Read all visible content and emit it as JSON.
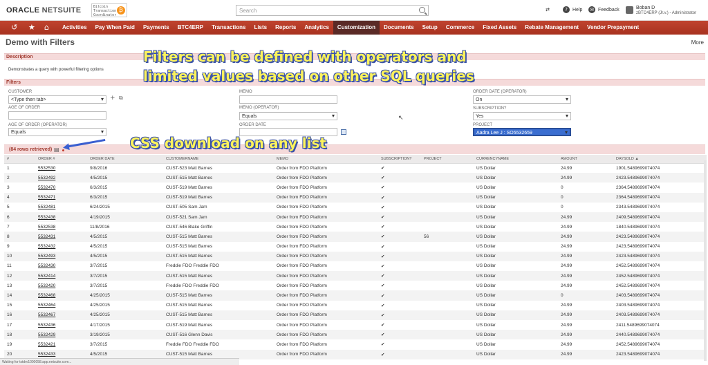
{
  "header": {
    "logo_main": "ORACLE",
    "logo_sub": "NETSUITE",
    "coin_text": "Bitcoin Transaction Coordinator",
    "coin_symbol": "₿",
    "search_placeholder": "Search",
    "help": "Help",
    "feedback": "Feedback",
    "user_name": "Boban D",
    "user_role": "zBTC4ERP (Jr.v.) - Administrator"
  },
  "nav": {
    "items": [
      "Activities",
      "Pay When Paid",
      "Payments",
      "BTC4ERP",
      "Transactions",
      "Lists",
      "Reports",
      "Analytics",
      "Customization",
      "Documents",
      "Setup",
      "Commerce",
      "Fixed Assets",
      "Rebate Management",
      "Vendor Prepayment"
    ],
    "active": "Customization"
  },
  "page": {
    "title": "Demo with Filters",
    "more": "More",
    "description_section": "Description",
    "description_text": "Demonstrates a query with powerful filtering options",
    "filters_section": "Filters"
  },
  "overlay": {
    "line1": "Filters can be defined with operators and",
    "line2": "limited values based on other SQL queries",
    "line3": "CSS download on any list"
  },
  "filters": {
    "customer_label": "CUSTOMER",
    "customer_value": "<Type then tab>",
    "age_label": "AGE OF ORDER",
    "age_value": "",
    "age_op_label": "AGE OF ORDER (OPERATOR)",
    "age_op_value": "Equals",
    "memo_label": "MEMO",
    "memo_value": "",
    "memo_op_label": "MEMO (OPERATOR)",
    "memo_op_value": "Equals",
    "order_date_label": "ORDER DATE",
    "order_date_value": "",
    "order_date_op_label": "ORDER DATE (OPERATOR)",
    "order_date_op_value": "On",
    "subscription_label": "SUBSCRIPTION?",
    "subscription_value": "Yes",
    "project_label": "PROJECT",
    "project_value": "Aadra Lee J : SO5532659"
  },
  "results": {
    "count_text": "(84 rows retrieved)",
    "columns": [
      "#",
      "ORDER #",
      "ORDER DATE",
      "CUSTOMERNAME",
      "MEMO",
      "SUBSCRIPTION?",
      "PROJECT",
      "CURRENCYNAME",
      "AMOUNT",
      "DAYSOLD ▲"
    ],
    "rows": [
      [
        "1",
        "5532530",
        "9/8/2016",
        "CUST-523 Matt Barnes",
        "Order from FDO Platform",
        "✔",
        "",
        "US Dollar",
        "24.99",
        "1901.5489699074074"
      ],
      [
        "2",
        "5532492",
        "4/5/2015",
        "CUST-515 Matt Barnes",
        "Order from FDO Platform",
        "✔",
        "",
        "US Dollar",
        "24.99",
        "2423.5489699074074"
      ],
      [
        "3",
        "5532470",
        "6/3/2015",
        "CUST-519 Matt Barnes",
        "Order from FDO Platform",
        "✔",
        "",
        "US Dollar",
        "0",
        "2364.5489699074074"
      ],
      [
        "4",
        "5532471",
        "6/3/2015",
        "CUST-519 Matt Barnes",
        "Order from FDO Platform",
        "✔",
        "",
        "US Dollar",
        "0",
        "2364.5489699074074"
      ],
      [
        "5",
        "5532481",
        "6/24/2015",
        "CUST-505 Sam Jam",
        "Order from FDO Platform",
        "✔",
        "",
        "US Dollar",
        "0",
        "2343.5489699074074"
      ],
      [
        "6",
        "5532438",
        "4/19/2015",
        "CUST-521 Sam Jam",
        "Order from FDO Platform",
        "✔",
        "",
        "US Dollar",
        "24.99",
        "2409.5489699074074"
      ],
      [
        "7",
        "5532538",
        "11/8/2016",
        "CUST-546 Blake Griffin",
        "Order from FDO Platform",
        "✔",
        "",
        "US Dollar",
        "24.99",
        "1840.5489699074074"
      ],
      [
        "8",
        "5532431",
        "4/5/2015",
        "CUST-515 Matt Barnes",
        "Order from FDO Platform",
        "✔",
        "56",
        "US Dollar",
        "24.99",
        "2423.5489699074074"
      ],
      [
        "9",
        "5532432",
        "4/5/2015",
        "CUST-515 Matt Barnes",
        "Order from FDO Platform",
        "✔",
        "",
        "US Dollar",
        "24.99",
        "2423.5489699074074"
      ],
      [
        "10",
        "5532493",
        "4/5/2015",
        "CUST-515 Matt Barnes",
        "Order from FDO Platform",
        "✔",
        "",
        "US Dollar",
        "24.99",
        "2423.5489699074074"
      ],
      [
        "11",
        "5532430",
        "3/7/2015",
        "Freddie FDO Freddie FDO",
        "Order from FDO Platform",
        "✔",
        "",
        "US Dollar",
        "24.99",
        "2452.5489699074074"
      ],
      [
        "12",
        "5532414",
        "3/7/2015",
        "CUST-515 Matt Barnes",
        "Order from FDO Platform",
        "✔",
        "",
        "US Dollar",
        "24.99",
        "2452.5489699074074"
      ],
      [
        "13",
        "5532420",
        "3/7/2015",
        "Freddie FDO Freddie FDO",
        "Order from FDO Platform",
        "✔",
        "",
        "US Dollar",
        "24.99",
        "2452.5489699074074"
      ],
      [
        "14",
        "5532468",
        "4/25/2015",
        "CUST-515 Matt Barnes",
        "Order from FDO Platform",
        "✔",
        "",
        "US Dollar",
        "0",
        "2403.5489699074074"
      ],
      [
        "15",
        "5532464",
        "4/25/2015",
        "CUST-515 Matt Barnes",
        "Order from FDO Platform",
        "✔",
        "",
        "US Dollar",
        "24.99",
        "2403.5489699074074"
      ],
      [
        "16",
        "5532467",
        "4/25/2015",
        "CUST-515 Matt Barnes",
        "Order from FDO Platform",
        "✔",
        "",
        "US Dollar",
        "24.99",
        "2403.5489699074074"
      ],
      [
        "17",
        "5532436",
        "4/17/2015",
        "CUST-519 Matt Barnes",
        "Order from FDO Platform",
        "✔",
        "",
        "US Dollar",
        "24.99",
        "2411.5489699074074"
      ],
      [
        "18",
        "5532429",
        "3/19/2015",
        "CUST-516 Glenn Davis",
        "Order from FDO Platform",
        "✔",
        "",
        "US Dollar",
        "24.99",
        "2440.5489699074074"
      ],
      [
        "19",
        "5532421",
        "3/7/2015",
        "Freddie FDO Freddie FDO",
        "Order from FDO Platform",
        "✔",
        "",
        "US Dollar",
        "24.99",
        "2452.5489699074074"
      ],
      [
        "20",
        "5532433",
        "4/5/2015",
        "CUST-515 Matt Barnes",
        "Order from FDO Platform",
        "✔",
        "",
        "US Dollar",
        "24.99",
        "2423.5489699074074"
      ]
    ]
  },
  "status_text": "Waiting for tstdrv1000058.app.netsuite.com..."
}
